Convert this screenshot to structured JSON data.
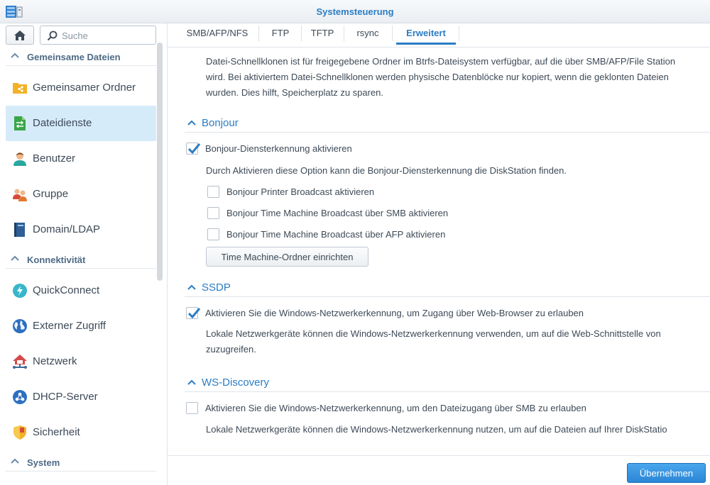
{
  "window": {
    "title": "Systemsteuerung"
  },
  "search": {
    "placeholder": "Suche"
  },
  "sidebar": {
    "sections": [
      {
        "label": "Gemeinsame Dateien",
        "items": [
          {
            "label": "Gemeinsamer Ordner",
            "icon": "shared-folder-icon"
          },
          {
            "label": "Dateidienste",
            "icon": "file-services-icon",
            "active": true
          },
          {
            "label": "Benutzer",
            "icon": "user-icon"
          },
          {
            "label": "Gruppe",
            "icon": "group-icon"
          },
          {
            "label": "Domain/LDAP",
            "icon": "domain-ldap-icon"
          }
        ]
      },
      {
        "label": "Konnektivität",
        "items": [
          {
            "label": "QuickConnect",
            "icon": "quickconnect-icon"
          },
          {
            "label": "Externer Zugriff",
            "icon": "globe-icon"
          },
          {
            "label": "Netzwerk",
            "icon": "network-house-icon"
          },
          {
            "label": "DHCP-Server",
            "icon": "dhcp-icon"
          },
          {
            "label": "Sicherheit",
            "icon": "shield-icon"
          }
        ]
      },
      {
        "label": "System",
        "items": []
      }
    ]
  },
  "tabs": [
    {
      "label": "SMB/AFP/NFS"
    },
    {
      "label": "FTP"
    },
    {
      "label": "TFTP"
    },
    {
      "label": "rsync"
    },
    {
      "label": "Erweitert",
      "active": true
    }
  ],
  "content": {
    "intro_lines": [
      "Datei-Schnellklonen ist für freigegebene Ordner im Btrfs-Dateisystem verfügbar, auf die über SMB/AFP/File Station",
      "wird. Bei aktiviertem Datei-Schnellklonen werden physische Datenblöcke nur kopiert, wenn die geklonten Dateien",
      "wurden. Dies hilft, Speicherplatz zu sparen."
    ],
    "bonjour": {
      "title": "Bonjour",
      "enable_label": "Bonjour-Diensterkennung aktivieren",
      "enable_checked": true,
      "description": "Durch Aktivieren diese Option kann die Bonjour-Diensterkennung die DiskStation finden.",
      "options": [
        {
          "label": "Bonjour Printer Broadcast aktivieren",
          "checked": false
        },
        {
          "label": "Bonjour Time Machine Broadcast über SMB aktivieren",
          "checked": false
        },
        {
          "label": "Bonjour Time Machine Broadcast über AFP aktivieren",
          "checked": false
        }
      ],
      "tm_button": "Time Machine-Ordner einrichten"
    },
    "ssdp": {
      "title": "SSDP",
      "enable_label": "Aktivieren Sie die Windows-Netzwerkerkennung, um Zugang über Web-Browser zu erlauben",
      "enable_checked": true,
      "description_lines": [
        "Lokale Netzwerkgeräte können die Windows-Netzwerkerkennung verwenden, um auf die Web-Schnittstelle von",
        "zuzugreifen."
      ]
    },
    "ws_discovery": {
      "title": "WS-Discovery",
      "enable_label": "Aktivieren Sie die Windows-Netzwerkerkennung, um den Dateizugang über SMB zu erlauben",
      "enable_checked": false,
      "description": "Lokale Netzwerkgeräte können die Windows-Netzwerkerkennung nutzen, um auf die Dateien auf Ihrer DiskStatio"
    }
  },
  "footer": {
    "apply_label": "Übernehmen"
  },
  "colors": {
    "accent": "#2a7dc5",
    "active_bg": "#d6ebfa"
  }
}
